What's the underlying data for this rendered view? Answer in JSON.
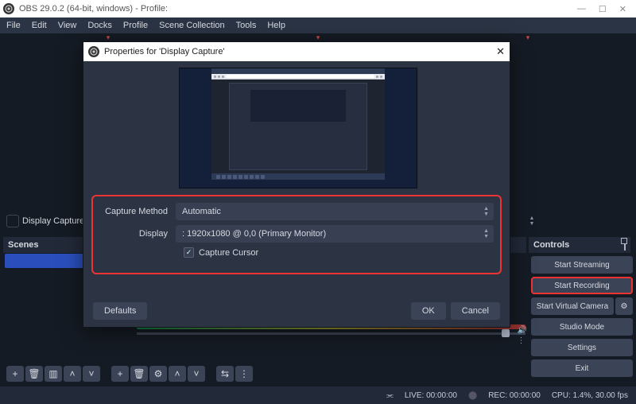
{
  "window": {
    "title": "OBS 29.0.2 (64-bit, windows) - Profile:",
    "controls": {
      "min": "—",
      "max": "☐",
      "close": "✕"
    }
  },
  "menu": [
    "File",
    "Edit",
    "View",
    "Docks",
    "Profile",
    "Scene Collection",
    "Tools",
    "Help"
  ],
  "source_row": {
    "label": "Display Capture"
  },
  "panels": {
    "scenes": "Scenes",
    "controls": "Controls"
  },
  "controls": {
    "start_streaming": "Start Streaming",
    "start_recording": "Start Recording",
    "start_virtual_camera": "Start Virtual Camera",
    "gear": "⚙",
    "studio_mode": "Studio Mode",
    "settings": "Settings",
    "exit": "Exit"
  },
  "toolbar_icons": {
    "plus": "+",
    "trash": "🗑",
    "cols": "▥",
    "up": "˄",
    "down": "˅",
    "gear": "⚙",
    "link": "⇆",
    "more": "⋮"
  },
  "status": {
    "live_label": "LIVE:",
    "live_time": "00:00:00",
    "rec_label": "REC:",
    "rec_time": "00:00:00",
    "cpu": "CPU: 1.4%, 30.00 fps"
  },
  "dialog": {
    "title": "Properties for 'Display Capture'",
    "capture_method_label": "Capture Method",
    "capture_method_value": "Automatic",
    "display_label": "Display",
    "display_value": ": 1920x1080 @ 0,0 (Primary Monitor)",
    "capture_cursor_label": "Capture Cursor",
    "capture_cursor_checked": "✓",
    "defaults": "Defaults",
    "ok": "OK",
    "cancel": "Cancel",
    "close": "✕"
  }
}
